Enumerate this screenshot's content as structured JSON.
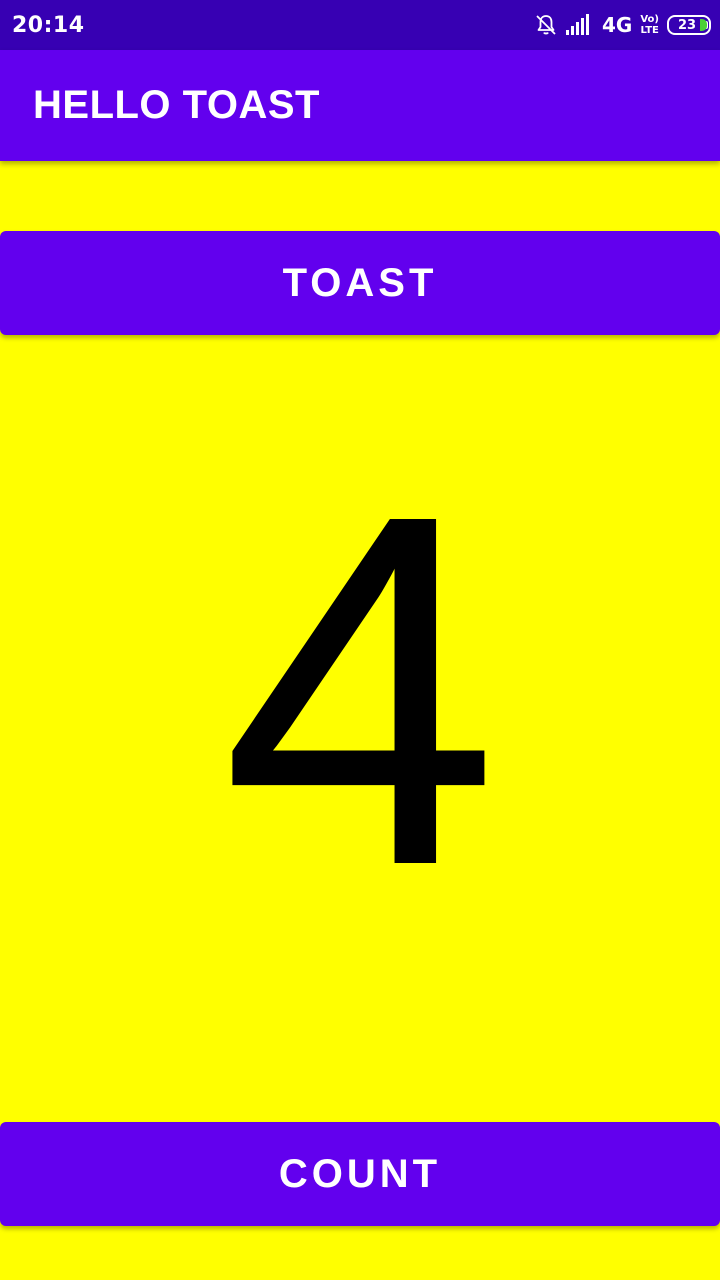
{
  "status_bar": {
    "time": "20:14",
    "network": "4G",
    "volte_top": "Vo)",
    "volte_bottom": "LTE",
    "battery": "23",
    "icons": [
      "notifications-off-icon",
      "signal-icon",
      "battery-icon"
    ]
  },
  "app_bar": {
    "title": "HELLO TOAST"
  },
  "buttons": {
    "toast_label": "TOAST",
    "count_label": "COUNT"
  },
  "count": {
    "value": "4"
  },
  "colors": {
    "status_bar": "#3700b3",
    "primary": "#6200ee",
    "background": "#ffff00",
    "count_text": "#000000",
    "battery_fill": "#4cd137"
  }
}
